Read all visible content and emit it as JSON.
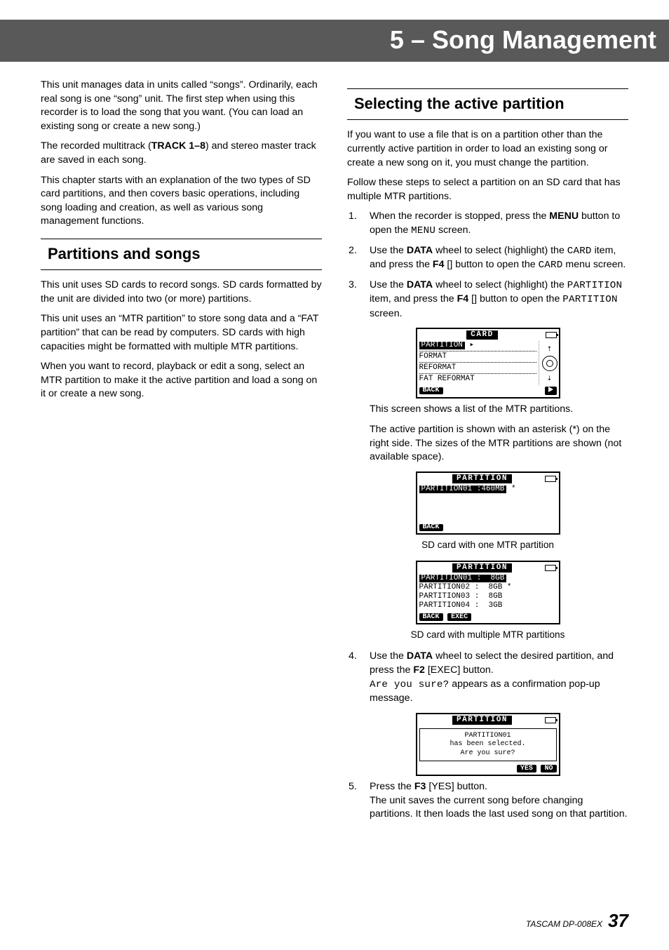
{
  "chapter_title": "5 – Song Management",
  "left": {
    "p1": "This unit manages data in units called “songs”. Ordinarily, each real song is one “song” unit. The first step when using this recorder is to load the song that you want. (You can load an existing song or create a new song.)",
    "p2a": "The recorded multitrack (",
    "p2b": "TRACK 1–8",
    "p2c": ") and stereo master track are saved in each song.",
    "p3": "This chapter starts with an explanation of the two types of SD card partitions, and then covers basic operations, including song loading and creation, as well as various song management functions.",
    "h2": "Partitions and songs",
    "p4": "This unit uses SD cards to record songs. SD cards formatted by the unit are divided into two (or more) partitions.",
    "p5": "This unit uses an “MTR partition” to store song data and a “FAT partition” that can be read by computers. SD cards with high capacities might be formatted with multiple MTR partitions.",
    "p6": "When you want to record, playback or edit a song, select an MTR partition to make it the active partition and load a song on it or create a new song."
  },
  "right": {
    "h2": "Selecting the active partition",
    "p1": "If you want to use a file that is on a partition other than the currently active partition in order to load an existing song or create a new song on it, you must change the partition.",
    "p2": "Follow these steps to select a partition on an SD card that has multiple MTR partitions.",
    "steps": {
      "s1_a": "When the recorder is stopped, press the ",
      "s1_menu": "MENU",
      "s1_b": " button to open the ",
      "s1_MENU": "MENU",
      "s1_c": " screen.",
      "s2_a": "Use the ",
      "s2_data": "DATA",
      "s2_b": " wheel to select (highlight) the ",
      "s2_card": "CARD",
      "s2_c": " item, and press the ",
      "s2_f4": "F4",
      "s2_d": " [",
      "s2_e": "] button to open the ",
      "s2_card2": "CARD",
      "s2_f": " menu screen.",
      "s3_a": "Use the ",
      "s3_data": "DATA",
      "s3_b": " wheel to select (highlight) the ",
      "s3_part": "PARTITION",
      "s3_c": " item, and press the ",
      "s3_f4": "F4",
      "s3_d": " [",
      "s3_e": "] button to open the ",
      "s3_part2": "PARTITION",
      "s3_f": " screen.",
      "after_fig1_a": "This screen shows a list of the MTR partitions.",
      "after_fig1_b": "The active partition is shown with an asterisk (*) on the right side. The sizes of the MTR partitions are shown (not available space).",
      "cap1": "SD card with one MTR partition",
      "cap2": "SD card with multiple MTR partitions",
      "s4_a": "Use the ",
      "s4_data": "DATA",
      "s4_b": " wheel to select the desired partition, and press the ",
      "s4_f2": "F2",
      "s4_c": " [EXEC] button.",
      "s4_d": "Are you sure?",
      "s4_e": " appears as a confirmation pop-up message.",
      "s5_a": "Press the ",
      "s5_f3": "F3",
      "s5_b": " [YES] button.",
      "s5_c": "The unit saves the current song before changing partitions. It then loads the last used song on that partition."
    }
  },
  "lcd1": {
    "title": "CARD",
    "rows": [
      "PARTITION",
      "FORMAT",
      "REFORMAT",
      "FAT REFORMAT"
    ],
    "back": "BACK"
  },
  "lcd2": {
    "title": "PARTITION",
    "row": "PARTITION01 :460MB",
    "star": "*",
    "back": "BACK"
  },
  "lcd3": {
    "title": "PARTITION",
    "rows": [
      "PARTITION01 :  8GB",
      "PARTITION02 :  8GB *",
      "PARTITION03 :  8GB",
      "PARTITION04 :  3GB"
    ],
    "back": "BACK",
    "exec": "EXEC"
  },
  "lcd4": {
    "title": "PARTITION",
    "line1": "PARTITION01",
    "line2": "has been selected.",
    "line3": "Are you sure?",
    "yes": "YES",
    "no": "NO"
  },
  "footer": {
    "model": "TASCAM  DP-008EX",
    "page": "37"
  }
}
